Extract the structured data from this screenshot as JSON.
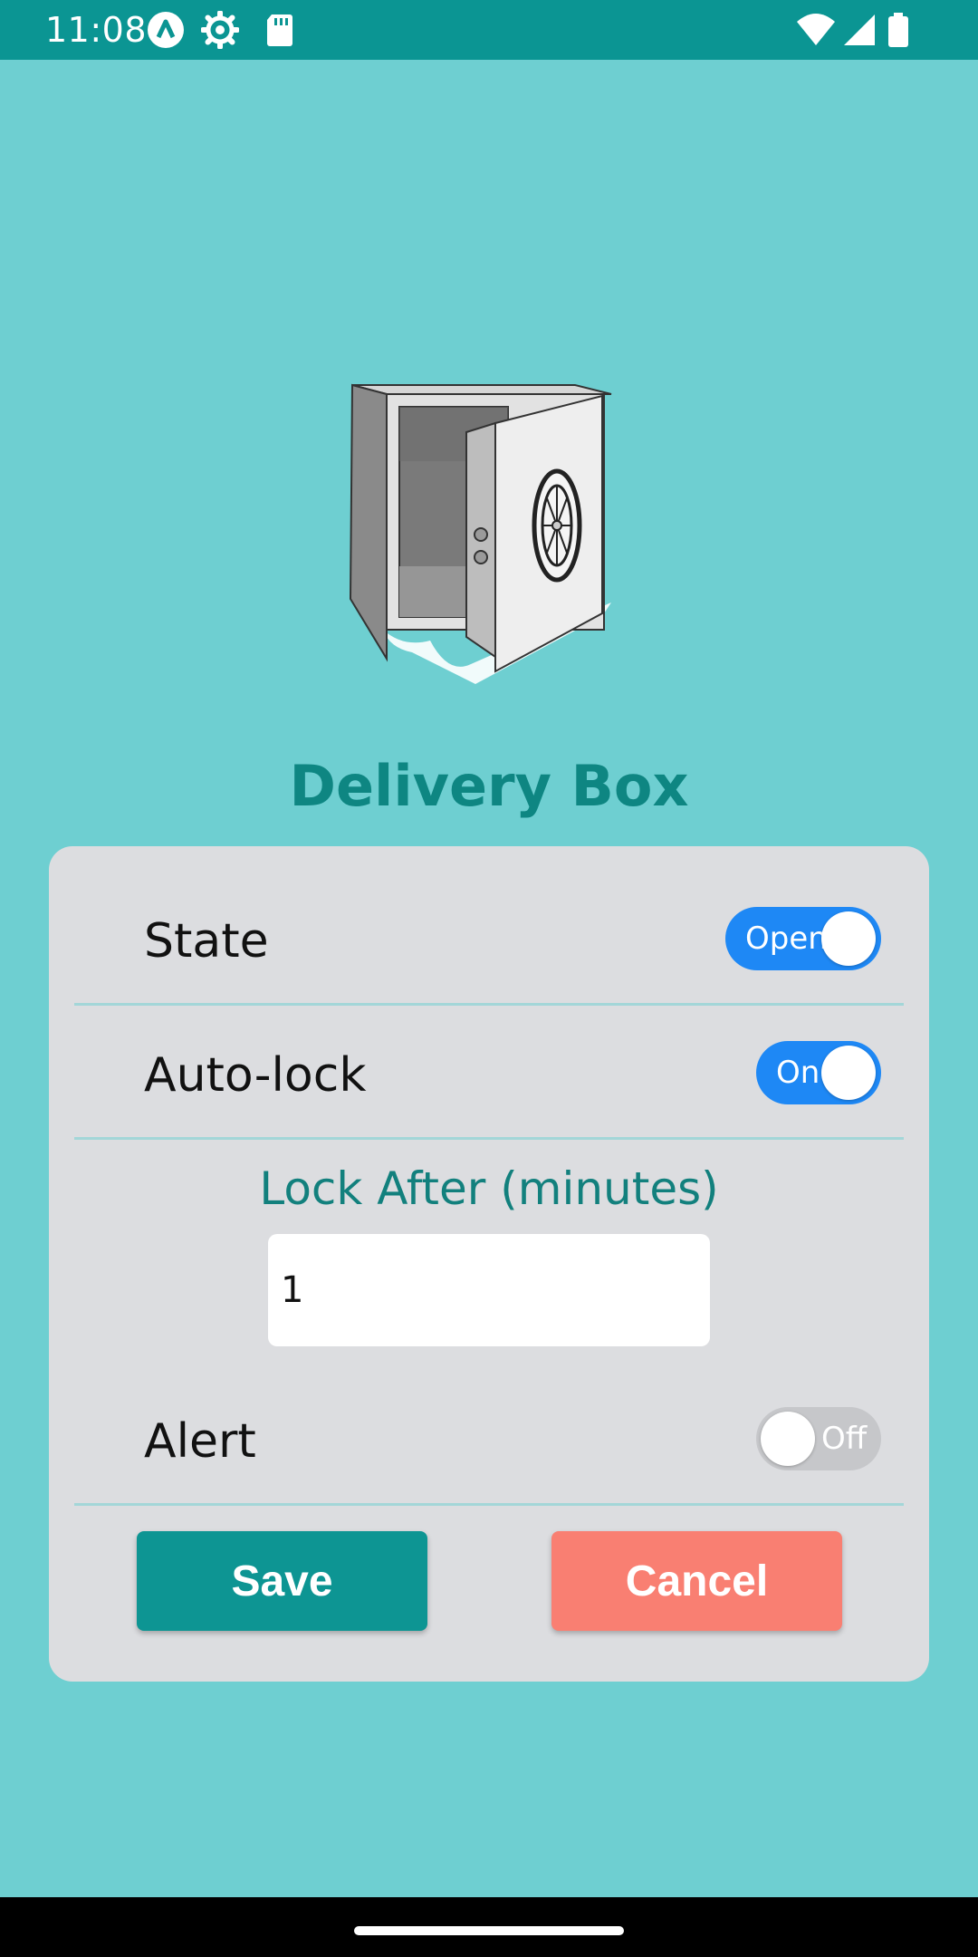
{
  "status_bar": {
    "time": "11:08",
    "icons_left": [
      "app-notification-icon",
      "settings-gear-icon",
      "sd-card-icon"
    ],
    "icons_right": [
      "wifi-icon",
      "signal-icon",
      "battery-icon"
    ]
  },
  "app": {
    "title": "Delivery Box",
    "illustration": "open-safe-icon"
  },
  "settings": {
    "state": {
      "label": "State",
      "toggle_text": "Open",
      "on": true
    },
    "auto_lock": {
      "label": "Auto-lock",
      "toggle_text": "On",
      "on": true
    },
    "lock_after": {
      "label": "Lock After (minutes)",
      "value": "1"
    },
    "alert": {
      "label": "Alert",
      "toggle_text": "Off",
      "on": false
    }
  },
  "actions": {
    "save_label": "Save",
    "cancel_label": "Cancel"
  },
  "colors": {
    "background": "#6ecfd1",
    "status_bar": "#0b9593",
    "title": "#0e8682",
    "card": "#dcdde0",
    "toggle_on": "#1e88f5",
    "toggle_off": "#c6c7ca",
    "save": "#0d9593",
    "cancel": "#f97f72"
  }
}
